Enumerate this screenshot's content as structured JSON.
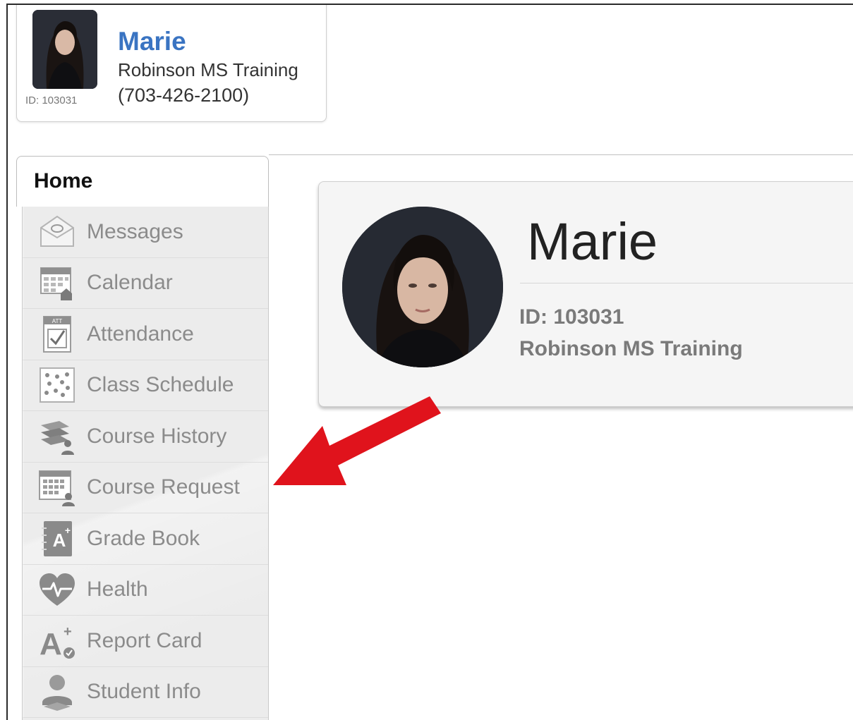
{
  "student_card": {
    "name": "Marie",
    "school": "Robinson MS Training",
    "phone": "(703-426-2100)",
    "id_label": "ID: 103031"
  },
  "nav": {
    "home_tab": "Home",
    "items": [
      {
        "label": "Messages",
        "icon": "envelope-icon"
      },
      {
        "label": "Calendar",
        "icon": "calendar-icon"
      },
      {
        "label": "Attendance",
        "icon": "attendance-icon"
      },
      {
        "label": "Class Schedule",
        "icon": "schedule-icon"
      },
      {
        "label": "Course History",
        "icon": "course-history-icon"
      },
      {
        "label": "Course Request",
        "icon": "course-request-icon"
      },
      {
        "label": "Grade Book",
        "icon": "grade-book-icon"
      },
      {
        "label": "Health",
        "icon": "heart-pulse-icon"
      },
      {
        "label": "Report Card",
        "icon": "report-card-icon"
      },
      {
        "label": "Student Info",
        "icon": "student-info-icon"
      }
    ]
  },
  "profile": {
    "name": "Marie",
    "id": "ID: 103031",
    "school": "Robinson MS Training"
  },
  "colors": {
    "name_blue": "#3a74c2",
    "arrow_red": "#e0131c"
  }
}
